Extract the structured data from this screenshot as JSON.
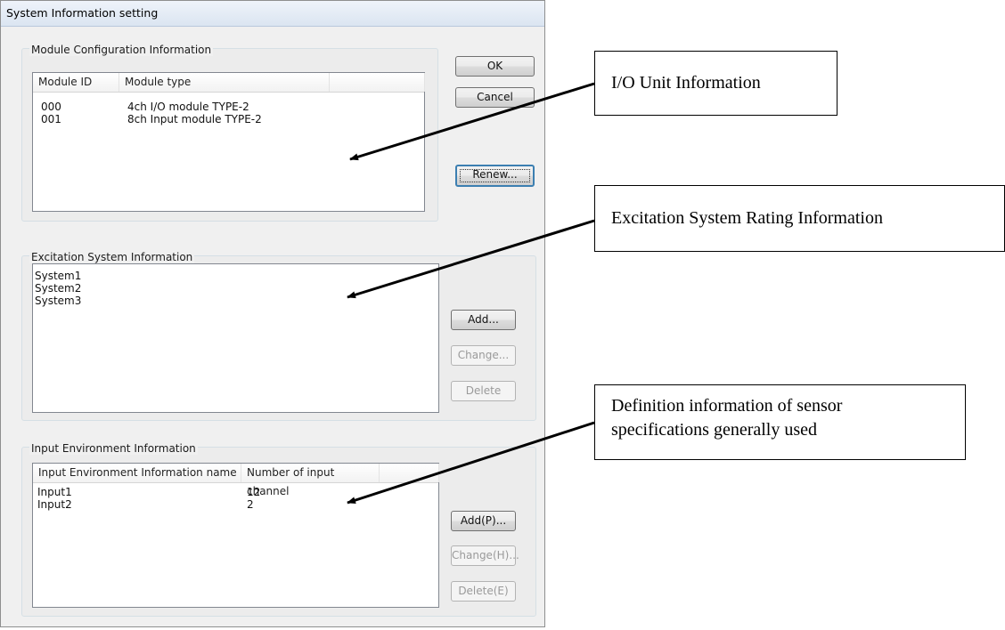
{
  "window": {
    "title": "System Information setting"
  },
  "module_config": {
    "label": "Module Configuration Information",
    "columns": [
      "Module ID",
      "Module type"
    ],
    "rows": [
      [
        "000",
        "4ch I/O module TYPE-2"
      ],
      [
        "001",
        "8ch Input module TYPE-2"
      ]
    ]
  },
  "buttons": {
    "ok": "OK",
    "cancel": "Cancel",
    "renew": "Renew...",
    "add": "Add...",
    "change": "Change...",
    "delete": "Delete",
    "add_p": "Add(P)...",
    "change_h": "Change(H)...",
    "delete_e": "Delete(E)"
  },
  "excitation": {
    "label": "Excitation System Information",
    "items": [
      "System1",
      "System2",
      "System3"
    ]
  },
  "input_env": {
    "label": "Input Environment Information",
    "columns": [
      "Input Environment Information name",
      "Number of input channel"
    ],
    "rows": [
      [
        "Input1",
        "12"
      ],
      [
        "Input2",
        "2"
      ]
    ]
  },
  "annotations": {
    "io_unit": "I/O Unit Information",
    "excitation_rating": "Excitation System Rating Information",
    "definition_line1": "Definition information of sensor",
    "definition_line2": "specifications generally used"
  }
}
